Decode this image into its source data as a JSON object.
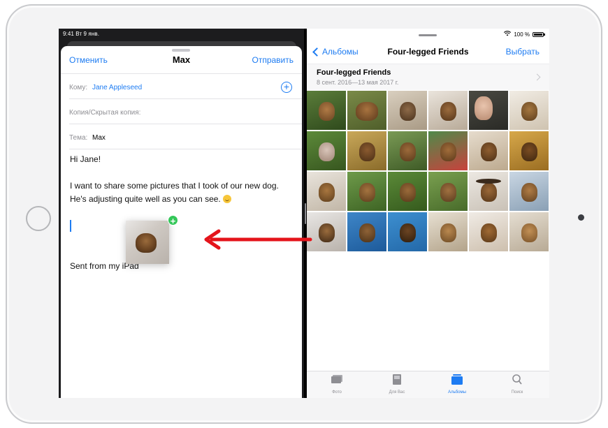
{
  "mail": {
    "status_time": "9:41  Вт 9 янв.",
    "cancel_label": "Отменить",
    "title": "Max",
    "send_label": "Отправить",
    "to_label": "Кому:",
    "to_value": "Jane Appleseed",
    "cc_label": "Копия/Скрытая копия:",
    "subject_label": "Тема:",
    "subject_value": "Max",
    "body_greeting": "Hi Jane!",
    "body_line1": "I want to share some pictures that I took of our new dog.",
    "body_line2": "He's adjusting quite well as you can see.",
    "signature": "Sent from my iPad"
  },
  "photos": {
    "status_battery": "100 %",
    "back_label": "Альбомы",
    "title": "Four-legged Friends",
    "select_label": "Выбрать",
    "album_title": "Four-legged Friends",
    "album_dates": "8 сент. 2016—13 мая 2017 г.",
    "tabs": [
      {
        "label": "Фото",
        "icon": "photos-tab-icon"
      },
      {
        "label": "Для Вас",
        "icon": "for-you-tab-icon"
      },
      {
        "label": "Альбомы",
        "icon": "albums-tab-icon"
      },
      {
        "label": "Поиск",
        "icon": "search-tab-icon"
      }
    ]
  },
  "colors": {
    "accent": "#1e7cf2",
    "drop_badge": "#34c759",
    "arrow": "#e4141b"
  }
}
